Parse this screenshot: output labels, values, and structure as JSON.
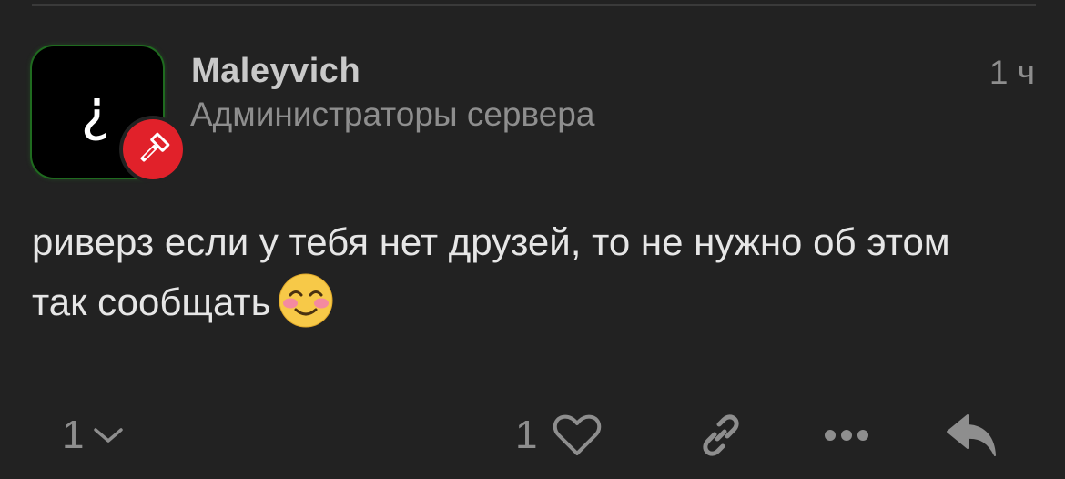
{
  "post": {
    "author": {
      "username": "Maleyvich",
      "group": "Администраторы сервера",
      "avatar_glyph": "¿",
      "badge_icon": "gavel-icon",
      "badge_color": "#e1212a"
    },
    "time": "1 ч",
    "text": "риверз если у тебя нет друзей, то не нужно об этом так сообщать",
    "emoji": "smiling-face-with-smiling-eyes"
  },
  "actions": {
    "replies_count": "1",
    "replies_icon": "chevron-down-icon",
    "likes_count": "1",
    "like_icon": "heart-icon",
    "link_icon": "link-icon",
    "more_icon": "ellipsis-icon",
    "reply_icon": "reply-icon"
  },
  "colors": {
    "background": "#222222",
    "text_primary": "#e6e6e6",
    "text_secondary": "#8e8e8e",
    "avatar_border": "#1f6b1f"
  }
}
